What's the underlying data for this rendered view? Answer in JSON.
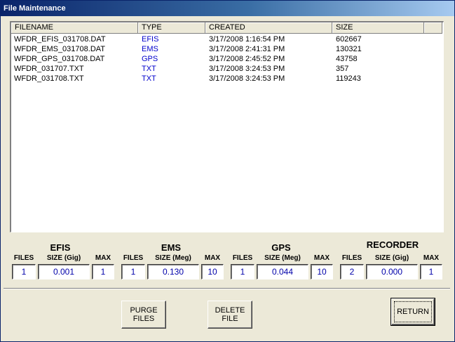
{
  "window": {
    "title": "File Maintenance"
  },
  "file_list": {
    "columns": [
      "FILENAME",
      "TYPE",
      "CREATED",
      "SIZE"
    ],
    "rows": [
      {
        "filename": "WFDR_EFIS_031708.DAT",
        "type": "EFIS",
        "created": "3/17/2008 1:16:54 PM",
        "size": "602667"
      },
      {
        "filename": "WFDR_EMS_031708.DAT",
        "type": "EMS",
        "created": "3/17/2008 2:41:31 PM",
        "size": "130321"
      },
      {
        "filename": "WFDR_GPS_031708.DAT",
        "type": "GPS",
        "created": "3/17/2008 2:45:52 PM",
        "size": "43758"
      },
      {
        "filename": "WFDR_031707.TXT",
        "type": "TXT",
        "created": "3/17/2008 3:24:53 PM",
        "size": "357"
      },
      {
        "filename": "WFDR_031708.TXT",
        "type": "TXT",
        "created": "3/17/2008 3:24:53 PM",
        "size": "119243"
      }
    ]
  },
  "stats": {
    "efis": {
      "title": "EFIS",
      "files_label": "FILES",
      "size_label": "SIZE (Gig)",
      "max_label": "MAX",
      "files": "1",
      "size": "0.001",
      "max": "1"
    },
    "ems": {
      "title": "EMS",
      "files_label": "FILES",
      "size_label": "SIZE (Meg)",
      "max_label": "MAX",
      "files": "1",
      "size": "0.130",
      "max": "10"
    },
    "gps": {
      "title": "GPS",
      "files_label": "FILES",
      "size_label": "SIZE (Meg)",
      "max_label": "MAX",
      "files": "1",
      "size": "0.044",
      "max": "10"
    },
    "recorder": {
      "title": "RECORDER",
      "files_label": "FILES",
      "size_label": "SIZE (Gig)",
      "max_label": "MAX",
      "files": "2",
      "size": "0.000",
      "max": "1"
    }
  },
  "buttons": {
    "purge_line1": "PURGE",
    "purge_line2": "FILES",
    "delete_line1": "DELETE",
    "delete_line2": "FILE",
    "return_label": "RETURN"
  },
  "colors": {
    "title_bar": "#0a246a",
    "type_text": "#0000cc",
    "field_text": "#0000aa",
    "face": "#ece9d8"
  }
}
